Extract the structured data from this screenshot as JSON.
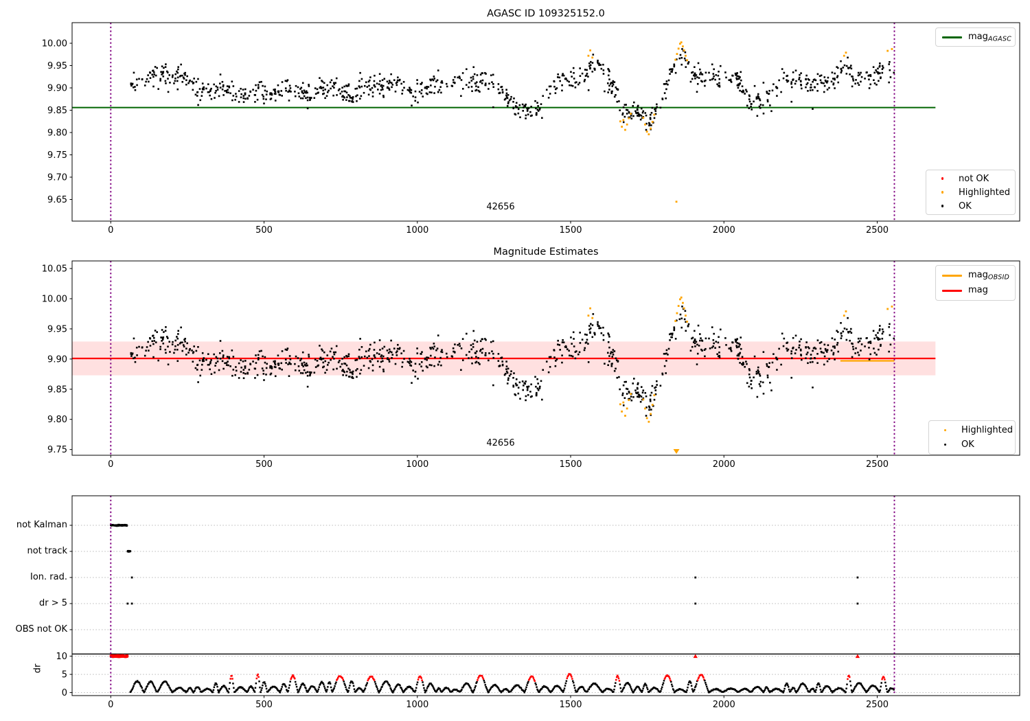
{
  "chart_data": [
    {
      "type": "scatter",
      "title": "AGASC ID 109325152.0",
      "xlabel": "",
      "ylabel": "",
      "xlim": [
        -126,
        2966
      ],
      "ylim": [
        9.6015,
        10.046
      ],
      "xtick_values": [
        0,
        500,
        1000,
        1500,
        2000,
        2500
      ],
      "xtick_labels": [
        "0",
        "500",
        "1000",
        "1500",
        "2000",
        "2500"
      ],
      "ytick_values": [
        10.0,
        9.95,
        9.9,
        9.85,
        9.8,
        9.75,
        9.7,
        9.65
      ],
      "ytick_labels": [
        "10.00",
        "9.95",
        "9.90",
        "9.85",
        "9.80",
        "9.75",
        "9.70",
        "9.65"
      ],
      "grid": false,
      "legend_line": {
        "position": "upper right",
        "items": [
          {
            "label_main": "mag",
            "label_sub": "AGASC",
            "color": "#006400",
            "swatch": "line"
          }
        ]
      },
      "legend_points": {
        "position": "lower right",
        "items": [
          {
            "label": "not OK",
            "color": "#ff0000"
          },
          {
            "label": "Highlighted",
            "color": "#ffa500"
          },
          {
            "label": "OK",
            "color": "#000000"
          }
        ]
      },
      "mag_agasc_line": {
        "value": 9.856,
        "x_start": -126,
        "x_end": 2690,
        "color": "#006400"
      },
      "vlines": {
        "x": [
          0,
          2556
        ],
        "color": "#800080",
        "style": "dotted"
      },
      "annotation": {
        "text": "42656",
        "x": 1272,
        "y": 9.631
      },
      "series_ok": {
        "name": "OK",
        "color": "#000000",
        "marker": "point",
        "x_start": 62,
        "x_end": 2556,
        "n": 1060,
        "noise_sigma": 0.0125,
        "trend": [
          [
            62,
            9.9
          ],
          [
            90,
            9.915
          ],
          [
            130,
            9.928
          ],
          [
            170,
            9.925
          ],
          [
            210,
            9.932
          ],
          [
            250,
            9.92
          ],
          [
            285,
            9.888
          ],
          [
            320,
            9.895
          ],
          [
            360,
            9.907
          ],
          [
            400,
            9.89
          ],
          [
            440,
            9.882
          ],
          [
            480,
            9.893
          ],
          [
            510,
            9.876
          ],
          [
            540,
            9.895
          ],
          [
            575,
            9.903
          ],
          [
            610,
            9.89
          ],
          [
            645,
            9.882
          ],
          [
            680,
            9.897
          ],
          [
            715,
            9.905
          ],
          [
            750,
            9.89
          ],
          [
            785,
            9.884
          ],
          [
            820,
            9.898
          ],
          [
            855,
            9.91
          ],
          [
            890,
            9.9
          ],
          [
            925,
            9.916
          ],
          [
            955,
            9.903
          ],
          [
            985,
            9.887
          ],
          [
            1015,
            9.893
          ],
          [
            1050,
            9.905
          ],
          [
            1085,
            9.912
          ],
          [
            1120,
            9.918
          ],
          [
            1155,
            9.908
          ],
          [
            1190,
            9.915
          ],
          [
            1225,
            9.92
          ],
          [
            1260,
            9.905
          ],
          [
            1295,
            9.882
          ],
          [
            1330,
            9.852
          ],
          [
            1365,
            9.845
          ],
          [
            1395,
            9.86
          ],
          [
            1430,
            9.895
          ],
          [
            1465,
            9.92
          ],
          [
            1500,
            9.928
          ],
          [
            1530,
            9.92
          ],
          [
            1560,
            9.945
          ],
          [
            1585,
            9.955
          ],
          [
            1612,
            9.935
          ],
          [
            1640,
            9.9
          ],
          [
            1665,
            9.85
          ],
          [
            1692,
            9.838
          ],
          [
            1715,
            9.858
          ],
          [
            1740,
            9.835
          ],
          [
            1762,
            9.822
          ],
          [
            1785,
            9.855
          ],
          [
            1810,
            9.9
          ],
          [
            1835,
            9.945
          ],
          [
            1858,
            9.97
          ],
          [
            1880,
            9.965
          ],
          [
            1900,
            9.94
          ],
          [
            1925,
            9.922
          ],
          [
            1955,
            9.93
          ],
          [
            1985,
            9.922
          ],
          [
            2015,
            9.912
          ],
          [
            2045,
            9.92
          ],
          [
            2075,
            9.878
          ],
          [
            2105,
            9.858
          ],
          [
            2135,
            9.872
          ],
          [
            2165,
            9.9
          ],
          [
            2195,
            9.918
          ],
          [
            2225,
            9.912
          ],
          [
            2255,
            9.92
          ],
          [
            2285,
            9.907
          ],
          [
            2315,
            9.912
          ],
          [
            2345,
            9.903
          ],
          [
            2375,
            9.93
          ],
          [
            2395,
            9.958
          ],
          [
            2420,
            9.922
          ],
          [
            2450,
            9.92
          ],
          [
            2480,
            9.93
          ],
          [
            2510,
            9.938
          ],
          [
            2540,
            9.945
          ],
          [
            2556,
            9.948
          ]
        ]
      },
      "series_highlighted": {
        "name": "Highlighted",
        "color": "#ffa500",
        "points": [
          [
            1558,
            9.972
          ],
          [
            1564,
            9.984
          ],
          [
            1571,
            9.968
          ],
          [
            1662,
            9.825
          ],
          [
            1667,
            9.813
          ],
          [
            1672,
            9.828
          ],
          [
            1678,
            9.806
          ],
          [
            1684,
            9.818
          ],
          [
            1690,
            9.832
          ],
          [
            1696,
            9.842
          ],
          [
            1737,
            9.833
          ],
          [
            1743,
            9.818
          ],
          [
            1749,
            9.802
          ],
          [
            1755,
            9.796
          ],
          [
            1761,
            9.809
          ],
          [
            1767,
            9.824
          ],
          [
            1773,
            9.84
          ],
          [
            1842,
            9.963
          ],
          [
            1847,
            9.976
          ],
          [
            1852,
            9.988
          ],
          [
            1857,
            9.999
          ],
          [
            1861,
            10.002
          ],
          [
            1866,
            9.993
          ],
          [
            1870,
            9.984
          ],
          [
            1875,
            9.972
          ],
          [
            1880,
            9.962
          ],
          [
            1845,
            9.645
          ],
          [
            2392,
            9.972
          ],
          [
            2398,
            9.979
          ],
          [
            2534,
            9.983
          ],
          [
            2548,
            9.987
          ]
        ]
      },
      "series_not_ok": {
        "name": "not OK",
        "color": "#ff0000",
        "points": []
      }
    },
    {
      "type": "scatter",
      "title": "Magnitude Estimates",
      "xlabel": "",
      "ylabel": "",
      "xlim": [
        -126,
        2966
      ],
      "ylim": [
        9.7405,
        10.0626
      ],
      "xtick_values": [
        0,
        500,
        1000,
        1500,
        2000,
        2500
      ],
      "xtick_labels": [
        "0",
        "500",
        "1000",
        "1500",
        "2000",
        "2500"
      ],
      "ytick_values": [
        10.05,
        10.0,
        9.95,
        9.9,
        9.85,
        9.8,
        9.75
      ],
      "ytick_labels": [
        "10.05",
        "10.00",
        "9.95",
        "9.90",
        "9.85",
        "9.80",
        "9.75"
      ],
      "grid": false,
      "legend_line": {
        "position": "upper right",
        "items": [
          {
            "label_main": "mag",
            "label_sub": "OBSID",
            "color": "#ffa500",
            "swatch": "line"
          },
          {
            "label_main": "mag",
            "label_sub": "",
            "color": "#ff0000",
            "swatch": "line"
          }
        ]
      },
      "legend_points": {
        "position": "lower right",
        "items": [
          {
            "label": "Highlighted",
            "color": "#ffa500"
          },
          {
            "label": "OK",
            "color": "#000000"
          }
        ]
      },
      "mag_line": {
        "value": 9.901,
        "x_start": -126,
        "x_end": 2690,
        "color": "#ff0000"
      },
      "mag_band": {
        "lo": 9.873,
        "hi": 9.929,
        "x_start": -126,
        "x_end": 2690,
        "color": "#ff0000",
        "alpha": 0.12
      },
      "obsid_segments": [
        [
          2380,
          2556,
          9.897
        ]
      ],
      "vlines": {
        "x": [
          0,
          2556
        ],
        "color": "#800080",
        "style": "dotted"
      },
      "annotation": {
        "text": "42656",
        "x": 1272,
        "y": 9.752
      },
      "clip_markers": [
        {
          "x": 1845,
          "direction": "down",
          "color": "#ffa500"
        }
      ],
      "series_shared_with_plot": 0
    },
    {
      "type": "scatter",
      "title": "",
      "xlabel": "",
      "xlim": [
        -126,
        2966
      ],
      "xtick_values": [
        0,
        500,
        1000,
        1500,
        2000,
        2500
      ],
      "xtick_labels": [
        "0",
        "500",
        "1000",
        "1500",
        "2000",
        "2500"
      ],
      "rows": [
        {
          "label": "not Kalman",
          "segments": [
            [
              0,
              53
            ]
          ],
          "points": []
        },
        {
          "label": "not track",
          "segments": [
            [
              55,
              64
            ]
          ],
          "points": []
        },
        {
          "label": "Ion. rad.",
          "segments": [],
          "points": [
            69,
            1907,
            2436
          ]
        },
        {
          "label": "dr > 5",
          "segments": [],
          "points": [
            55,
            69,
            1907,
            2436
          ]
        },
        {
          "label": "OBS not OK",
          "segments": [],
          "points": []
        }
      ],
      "dr": {
        "ylabel": "dr",
        "tick_values": [
          10,
          5,
          0
        ],
        "tick_labels": [
          "10",
          "5",
          "0"
        ],
        "threshold_line": 10.6,
        "clip_value": 10,
        "clip_segment": [
          0,
          55
        ],
        "clip_singles": [
          1907,
          2436
        ],
        "trace_x_start": 64,
        "trace_x_end": 2556,
        "red_arcs": [
          [
            390,
            4.6
          ],
          [
            470,
            4.8
          ],
          [
            600,
            4.5
          ],
          [
            737,
            4.4
          ],
          [
            860,
            4.3
          ],
          [
            1000,
            4.4
          ],
          [
            1215,
            4.6
          ],
          [
            1365,
            4.3
          ],
          [
            1515,
            5.0
          ],
          [
            1650,
            4.4
          ],
          [
            1838,
            4.6
          ],
          [
            1930,
            4.7
          ],
          [
            2400,
            4.5
          ],
          [
            2520,
            4.2
          ]
        ]
      },
      "vlines": {
        "x": [
          0,
          2556
        ],
        "color": "#800080",
        "style": "dotted"
      },
      "colors": {
        "ok": "#000000",
        "not_ok": "#ff0000",
        "gridline": "#b8b8b8"
      }
    }
  ]
}
